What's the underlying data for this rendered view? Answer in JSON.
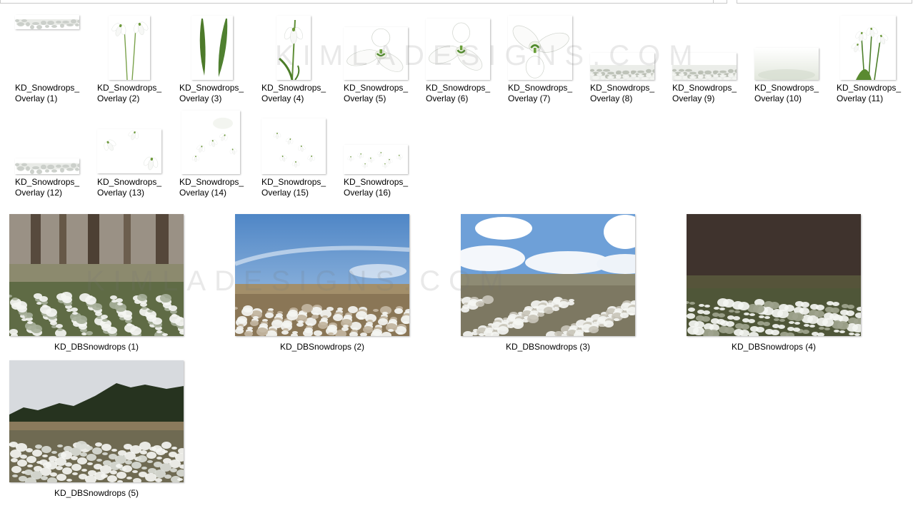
{
  "address_bar": {
    "value": ""
  },
  "search_box": {
    "value": ""
  },
  "watermark_text": "KIMLADESIGNS.COM",
  "overlays": [
    {
      "name": "KD_Snowdrops_Overlay (1)",
      "kind": "strip"
    },
    {
      "name": "KD_Snowdrops_Overlay (2)",
      "kind": "twostems"
    },
    {
      "name": "KD_Snowdrops_Overlay (3)",
      "kind": "leaves"
    },
    {
      "name": "KD_Snowdrops_Overlay (4)",
      "kind": "stem"
    },
    {
      "name": "KD_Snowdrops_Overlay (5)",
      "kind": "bloom"
    },
    {
      "name": "KD_Snowdrops_Overlay (6)",
      "kind": "bloomside"
    },
    {
      "name": "KD_Snowdrops_Overlay (7)",
      "kind": "bloomup"
    },
    {
      "name": "KD_Snowdrops_Overlay (8)",
      "kind": "field"
    },
    {
      "name": "KD_Snowdrops_Overlay (9)",
      "kind": "field"
    },
    {
      "name": "KD_Snowdrops_Overlay (10)",
      "kind": "blurfield"
    },
    {
      "name": "KD_Snowdrops_Overlay (11)",
      "kind": "cluster"
    },
    {
      "name": "KD_Snowdrops_Overlay (12)",
      "kind": "strip"
    },
    {
      "name": "KD_Snowdrops_Overlay (13)",
      "kind": "scatter"
    },
    {
      "name": "KD_Snowdrops_Overlay (14)",
      "kind": "falling"
    },
    {
      "name": "KD_Snowdrops_Overlay (15)",
      "kind": "falling2"
    },
    {
      "name": "KD_Snowdrops_Overlay (16)",
      "kind": "scatterwide"
    }
  ],
  "backgrounds": [
    {
      "name": "KD_DBSnowdrops (1)",
      "kind": "forest"
    },
    {
      "name": "KD_DBSnowdrops (2)",
      "kind": "bluesky"
    },
    {
      "name": "KD_DBSnowdrops (3)",
      "kind": "clouds"
    },
    {
      "name": "KD_DBSnowdrops (4)",
      "kind": "dark"
    },
    {
      "name": "KD_DBSnowdrops (5)",
      "kind": "treeline"
    }
  ]
}
